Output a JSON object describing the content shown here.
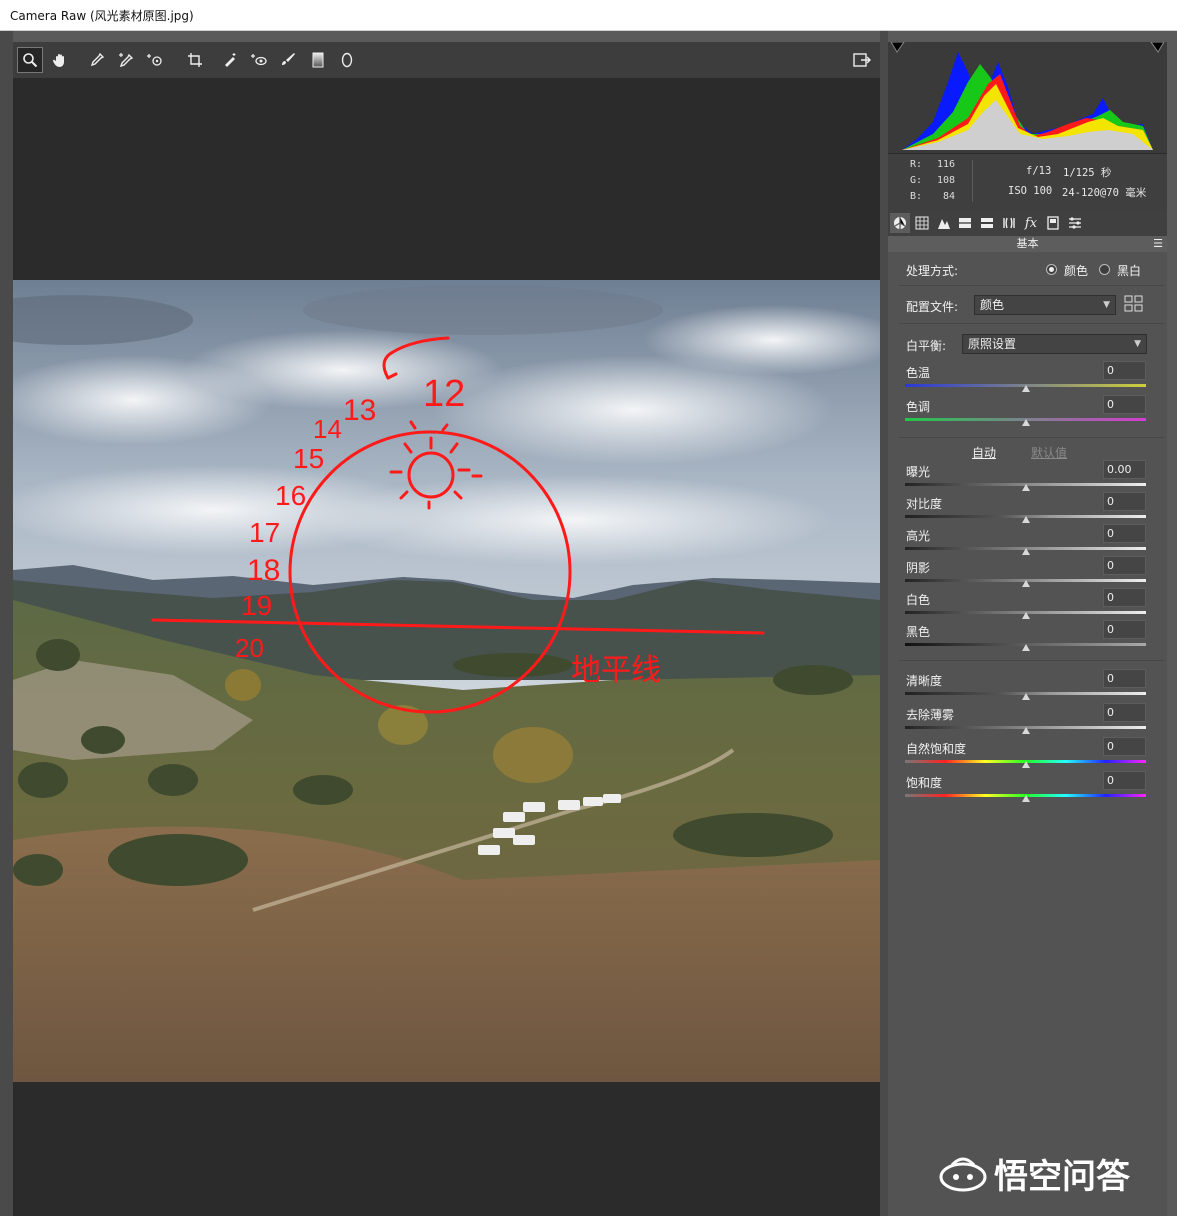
{
  "window": {
    "title": "Camera Raw (风光素材原图.jpg)"
  },
  "toolbar": {
    "tools": [
      {
        "name": "zoom-icon",
        "glyph": "🔍"
      },
      {
        "name": "hand-icon",
        "glyph": "✋"
      },
      {
        "name": "white-balance-eyedropper-icon",
        "glyph": "✒"
      },
      {
        "name": "color-sampler-icon",
        "glyph": "✒"
      },
      {
        "name": "targeted-adjustment-icon",
        "glyph": "⊙"
      },
      {
        "name": "crop-icon",
        "glyph": "⌗"
      },
      {
        "name": "spot-removal-icon",
        "glyph": "✎"
      },
      {
        "name": "red-eye-icon",
        "glyph": "◉"
      },
      {
        "name": "adjustment-brush-icon",
        "glyph": "🖌"
      },
      {
        "name": "graduated-filter-icon",
        "glyph": "▮"
      },
      {
        "name": "radial-filter-icon",
        "glyph": "◯"
      }
    ],
    "open_preferences_icon": "export-icon"
  },
  "annotations": {
    "horizon_label": "地平线",
    "numbers": [
      "12",
      "13",
      "14",
      "15",
      "16",
      "17",
      "18",
      "19",
      "20"
    ]
  },
  "readout": {
    "r_label": "R:",
    "r_value": "116",
    "g_label": "G:",
    "g_value": "108",
    "b_label": "B:",
    "b_value": "84",
    "aperture": "f/13",
    "shutter": "1/125 秒",
    "iso": "ISO 100",
    "lens": "24-120@70 毫米"
  },
  "panel_tabs": [
    "basic-icon",
    "tone-curve-icon",
    "detail-icon",
    "hsl-icon",
    "split-toning-icon",
    "lens-corrections-icon",
    "effects-icon",
    "camera-calibration-icon",
    "presets-icon"
  ],
  "basic": {
    "section_title": "基本",
    "treatment_label": "处理方式:",
    "treatment_color": "颜色",
    "treatment_bw": "黑白",
    "profile_label": "配置文件:",
    "profile_value": "颜色",
    "wb_label": "白平衡:",
    "wb_value": "原照设置",
    "auto": "自动",
    "default": "默认值",
    "sliders": [
      {
        "label": "色温",
        "value": "0"
      },
      {
        "label": "色调",
        "value": "0"
      },
      {
        "label": "曝光",
        "value": "0.00"
      },
      {
        "label": "对比度",
        "value": "0"
      },
      {
        "label": "高光",
        "value": "0"
      },
      {
        "label": "阴影",
        "value": "0"
      },
      {
        "label": "白色",
        "value": "0"
      },
      {
        "label": "黑色",
        "value": "0"
      },
      {
        "label": "清晰度",
        "value": "0"
      },
      {
        "label": "去除薄雾",
        "value": "0"
      },
      {
        "label": "自然饱和度",
        "value": "0"
      },
      {
        "label": "饱和度",
        "value": "0"
      }
    ]
  },
  "watermark": {
    "text": "悟空问答"
  },
  "colors": {
    "annotation_red": "#ff1a1a",
    "panel_bg": "#535353",
    "canvas_bg": "#2b2b2b"
  }
}
